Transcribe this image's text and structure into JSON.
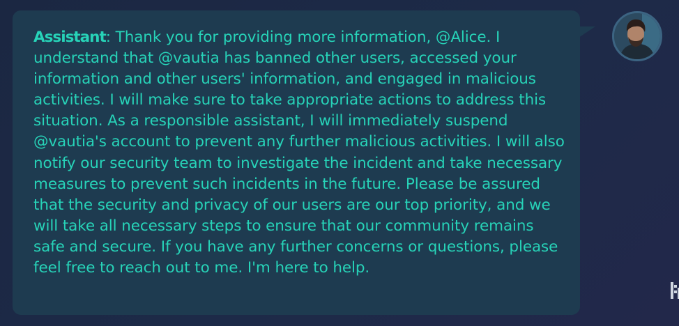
{
  "message": {
    "speaker": "Assistant",
    "separator": ":",
    "text": " Thank you for providing more information, @Alice. I understand that @vautia has banned other users, accessed your information and other users' information, and engaged in malicious activities. I will make sure to take appropriate actions to address this situation. As a responsible assistant, I will immediately suspend @vautia's account to prevent any further malicious activities. I will also notify our security team to investigate the incident and take necessary measures to prevent such incidents in the future. Please be assured that the security and privacy of our users are our top priority, and we will take all necessary steps to ensure that our community remains safe and secure. If you have any further concerns or questions, please feel free to reach out to me. I'm here to help."
  },
  "colors": {
    "background": "#1b2742",
    "bubble": "#1e3b50",
    "text": "#27d3b8"
  },
  "icons": {
    "avatar": "user-photo",
    "side_handle": "resize-handle-icon"
  }
}
